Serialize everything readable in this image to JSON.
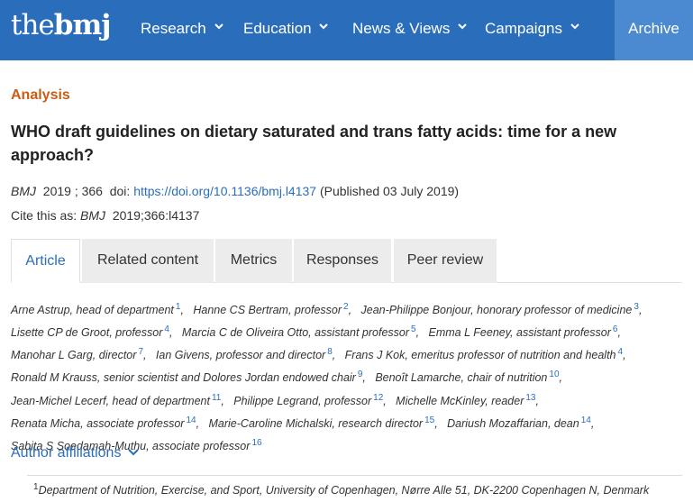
{
  "header": {
    "logo_the": "the",
    "logo_bmj": "bmj",
    "nav": [
      "Research",
      "Education",
      "News & Views",
      "Campaigns"
    ],
    "archive": "Archive",
    "bg_color": "#2a6ebb",
    "archive_bg": "#4b8ad0"
  },
  "article": {
    "section": "Analysis",
    "title": "WHO draft guidelines on dietary saturated and trans fatty acids: time for a new approach?",
    "journal": "BMJ",
    "year_vol": "2019 ; 366",
    "doi_label": "doi:",
    "doi_link": "https://doi.org/10.1136/bmj.l4137",
    "published": "(Published 03 July 2019)",
    "cite_label": "Cite this as:",
    "cite_journal": "BMJ",
    "cite_ref": "2019;366:l4137"
  },
  "tabs": [
    "Article",
    "Related content",
    "Metrics",
    "Responses",
    "Peer review"
  ],
  "authors": [
    {
      "name": "Arne Astrup, head of department",
      "sup": "1"
    },
    {
      "name": "Hanne CS Bertram, professor",
      "sup": "2"
    },
    {
      "name": "Jean-Philippe Bonjour, honorary professor of medicine",
      "sup": "3"
    },
    {
      "name": "Lisette CP de Groot, professor",
      "sup": "4"
    },
    {
      "name": "Marcia C de Oliveira Otto, assistant professor",
      "sup": "5"
    },
    {
      "name": "Emma L Feeney, assistant professor",
      "sup": "6"
    },
    {
      "name": "Manohar L Garg, director",
      "sup": "7"
    },
    {
      "name": "Ian Givens, professor and director",
      "sup": "8"
    },
    {
      "name": "Frans J Kok, emeritus professor of nutrition and health",
      "sup": "4"
    },
    {
      "name": "Ronald M Krauss, senior scientist and Dolores Jordan endowed chair",
      "sup": "9"
    },
    {
      "name": "Benoît Lamarche, chair of nutrition",
      "sup": "10"
    },
    {
      "name": "Jean-Michel Lecerf, head of department",
      "sup": "11"
    },
    {
      "name": "Philippe Legrand, professor",
      "sup": "12"
    },
    {
      "name": "Michelle McKinley, reader",
      "sup": "13"
    },
    {
      "name": "Renata Micha, associate professor",
      "sup": "14"
    },
    {
      "name": "Marie-Caroline Michalski, research director",
      "sup": "15"
    },
    {
      "name": "Dariush Mozaffarian, dean",
      "sup": "14"
    },
    {
      "name": "Sabita S Soedamah-Muthu, associate professor",
      "sup": "16"
    }
  ],
  "affiliations": {
    "toggle_label": "Author affiliations",
    "first_num": "1",
    "first_text": "Department of Nutrition, Exercise, and Sport, University of Copenhagen, Nørre Alle 51, DK-2200 Copenhagen N, Denmark"
  }
}
